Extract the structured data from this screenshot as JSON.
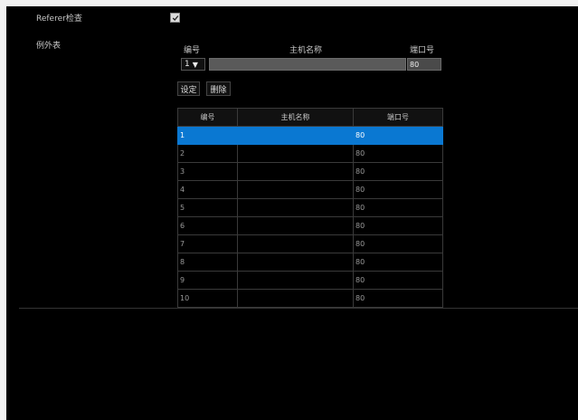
{
  "referer_check": {
    "label": "Referer检查",
    "checked": true
  },
  "exception_list": {
    "label": "例外表",
    "form": {
      "col_number": "编号",
      "col_host": "主机名称",
      "col_port": "端口号",
      "selected_number": "1",
      "host_value": "",
      "port_value": "80",
      "set_button": "设定",
      "delete_button": "删除"
    },
    "table": {
      "headers": [
        "编号",
        "主机名称",
        "端口号"
      ],
      "selected_row": 0,
      "rows": [
        {
          "number": "1",
          "host": "",
          "port": "80"
        },
        {
          "number": "2",
          "host": "",
          "port": "80"
        },
        {
          "number": "3",
          "host": "",
          "port": "80"
        },
        {
          "number": "4",
          "host": "",
          "port": "80"
        },
        {
          "number": "5",
          "host": "",
          "port": "80"
        },
        {
          "number": "6",
          "host": "",
          "port": "80"
        },
        {
          "number": "7",
          "host": "",
          "port": "80"
        },
        {
          "number": "8",
          "host": "",
          "port": "80"
        },
        {
          "number": "9",
          "host": "",
          "port": "80"
        },
        {
          "number": "10",
          "host": "",
          "port": "80"
        }
      ]
    }
  },
  "colors": {
    "background": "#000000",
    "selected_row": "#0a78d2",
    "page_border": "#f2f2f2"
  }
}
